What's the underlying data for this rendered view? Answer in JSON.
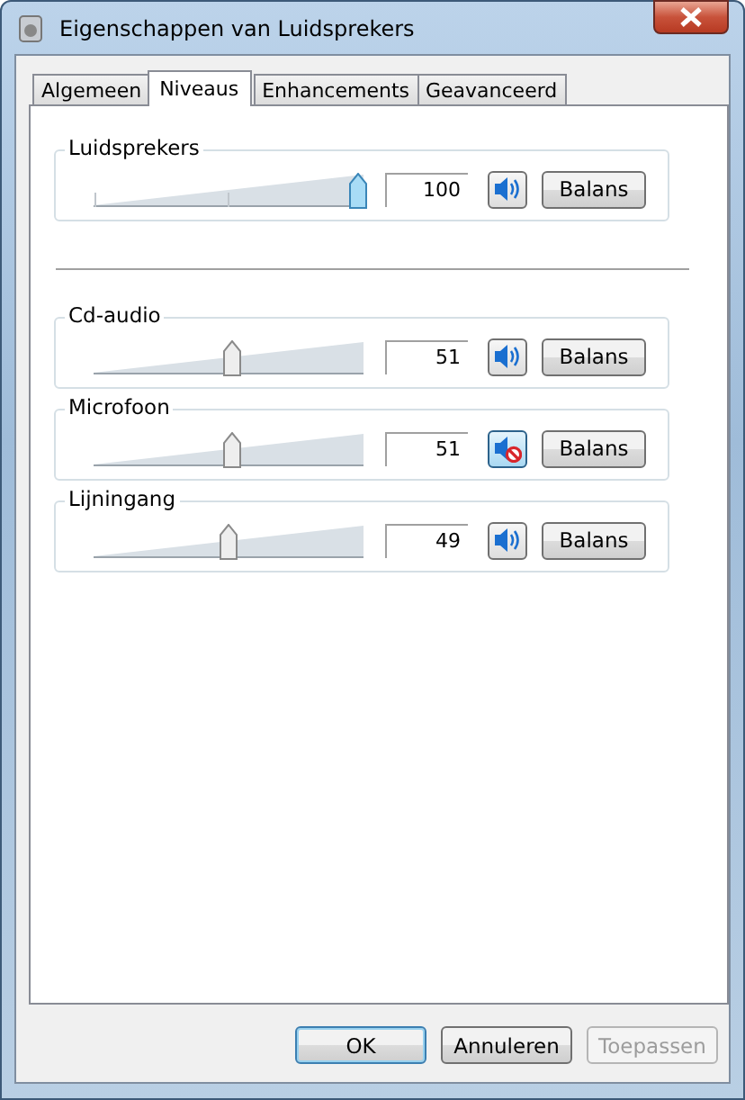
{
  "window": {
    "title": "Eigenschappen van Luidsprekers"
  },
  "tabs": [
    {
      "label": "Algemeen",
      "selected": false
    },
    {
      "label": "Niveaus",
      "selected": true
    },
    {
      "label": "Enhancements",
      "selected": false
    },
    {
      "label": "Geavanceerd",
      "selected": false
    }
  ],
  "master": {
    "name": "Luidsprekers",
    "level": 1,
    "value": "100",
    "muted": false,
    "balance_button": "Balans"
  },
  "channels": [
    {
      "name": "Cd-audio",
      "level": 0.51,
      "value": "51",
      "muted": false,
      "balance_button": "Balans"
    },
    {
      "name": "Microfoon",
      "level": 0.51,
      "value": "51",
      "muted": true,
      "balance_button": "Balans"
    },
    {
      "name": "Lijningang",
      "level": 0.49,
      "value": "49",
      "muted": false,
      "balance_button": "Balans"
    }
  ],
  "buttons": [
    {
      "label": "OK",
      "default": true,
      "disabled": false
    },
    {
      "label": "Annuleren",
      "default": false,
      "disabled": false
    },
    {
      "label": "Toepassen",
      "default": false,
      "disabled": true
    }
  ]
}
